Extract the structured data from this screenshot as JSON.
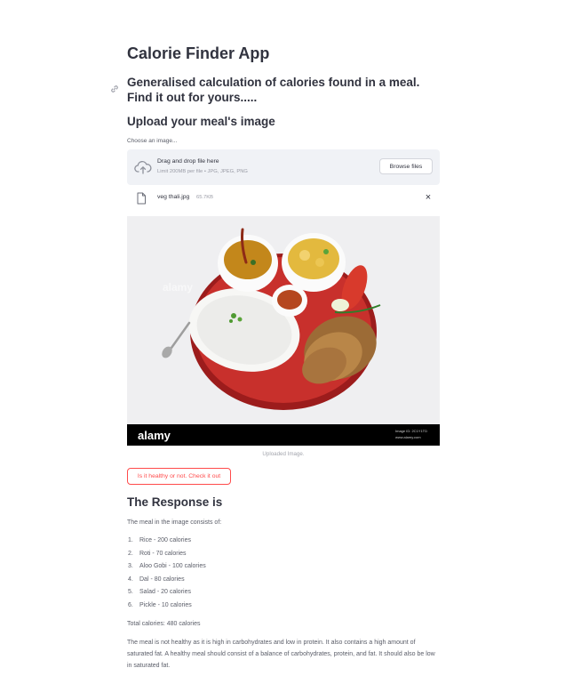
{
  "app": {
    "title": "Calorie Finder App",
    "subtitle": "Generalised calculation of calories found in a meal. Find it out for yours.....",
    "upload_heading": "Upload your meal's image"
  },
  "uploader": {
    "label": "Choose an image...",
    "drag_text": "Drag and drop file here",
    "limit_text": "Limit 200MB per file • JPG, JPEG, PNG",
    "browse_label": "Browse files",
    "file_name": "veg thali.jpg",
    "file_size": "65.7KB",
    "close_symbol": "×"
  },
  "image": {
    "caption": "Uploaded Image.",
    "watermark": "alamy",
    "footer_logo": "alamy",
    "footer_id": "Image ID: 2C1Y1TD",
    "footer_url": "www.alamy.com"
  },
  "action": {
    "check_label": "Is it healthy or not. Check it out"
  },
  "response": {
    "heading": "The Response is",
    "intro": "The meal in the image consists of:",
    "items": [
      {
        "num": "1.",
        "text": "Rice - 200 calories"
      },
      {
        "num": "2.",
        "text": "Roti - 70 calories"
      },
      {
        "num": "3.",
        "text": "Aloo Gobi - 100 calories"
      },
      {
        "num": "4.",
        "text": "Dal - 80 calories"
      },
      {
        "num": "5.",
        "text": "Salad - 20 calories"
      },
      {
        "num": "6.",
        "text": "Pickle - 10 calories"
      }
    ],
    "total": "Total calories: 480 calories",
    "verdict": "The meal is not healthy as it is high in carbohydrates and low in protein. It also contains a high amount of saturated fat. A healthy meal should consist of a balance of carbohydrates, protein, and fat. It should also be low in saturated fat."
  },
  "icons": {
    "upload": "cloud-upload-icon",
    "file": "file-icon",
    "close": "close-icon",
    "anchor": "link-icon"
  },
  "colors": {
    "accent": "#ff4b4b",
    "text": "#31333f",
    "dropzone_bg": "#f0f2f6"
  }
}
